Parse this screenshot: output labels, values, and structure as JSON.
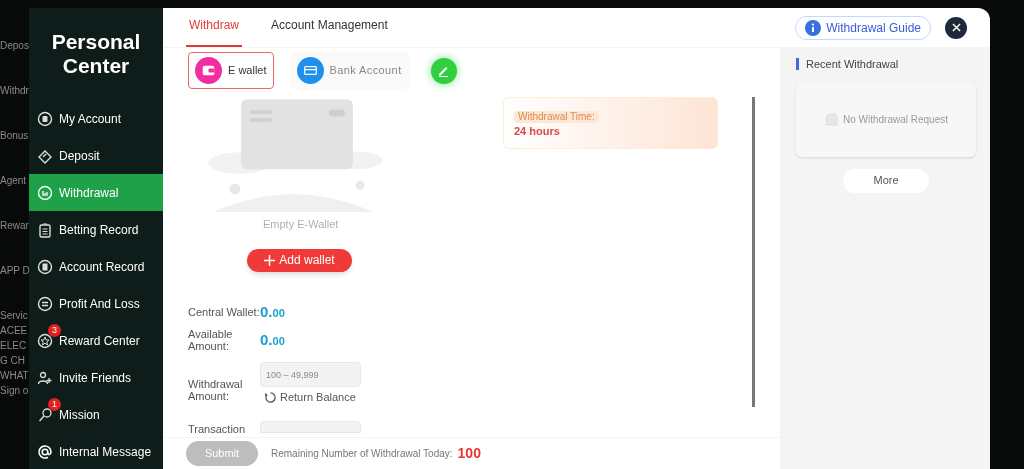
{
  "background_menu": [
    "Depos",
    "Withdr",
    "Bonus",
    "Agent",
    "Rewar",
    "APP D",
    "Servic",
    "ACEE",
    "ELEC",
    "G CH",
    "WHAT",
    "Sign o"
  ],
  "sidebar": {
    "title": "Personal Center",
    "items": [
      {
        "label": "My Account",
        "selected": false
      },
      {
        "label": "Deposit",
        "selected": false
      },
      {
        "label": "Withdrawal",
        "selected": true
      },
      {
        "label": "Betting Record",
        "selected": false
      },
      {
        "label": "Account Record",
        "selected": false
      },
      {
        "label": "Profit And Loss",
        "selected": false
      },
      {
        "label": "Reward Center",
        "selected": false,
        "badge": "3"
      },
      {
        "label": "Invite Friends",
        "selected": false
      },
      {
        "label": "Mission",
        "selected": false,
        "badge": "1"
      },
      {
        "label": "Internal Message",
        "selected": false
      }
    ]
  },
  "tabs": [
    {
      "label": "Withdraw",
      "selected": true
    },
    {
      "label": "Account Management",
      "selected": false
    }
  ],
  "guide_button": "Withdrawal Guide",
  "wallet_types": [
    {
      "label": "E wallet",
      "kind": "ewallet",
      "selected": true
    },
    {
      "label": "Bank Account",
      "kind": "bank",
      "selected": false
    },
    {
      "kind": "edit",
      "selected": false
    }
  ],
  "empty_text": "Empty E-Wallet",
  "add_wallet": "Add wallet",
  "withdrawal_time": {
    "label": "Withdrawal Time:",
    "value": "24 hours"
  },
  "balances": [
    {
      "label": "Central Wallet:",
      "whole": "0.",
      "decimals": "00"
    },
    {
      "label": "Available Amount:",
      "whole": "0.",
      "decimals": "00"
    }
  ],
  "amount": {
    "label": "Withdrawal Amount:",
    "placeholder": "100 – 49,999",
    "return_balance": "Return Balance"
  },
  "transaction_label": "Transaction",
  "footer": {
    "submit": "Submit",
    "submit_disabled": true,
    "remaining_label": "Remaining Number of Withdrawal Today:",
    "remaining_value": "100"
  },
  "recent": {
    "title": "Recent Withdrawal",
    "empty": "No Withdrawal Request",
    "more": "More"
  }
}
